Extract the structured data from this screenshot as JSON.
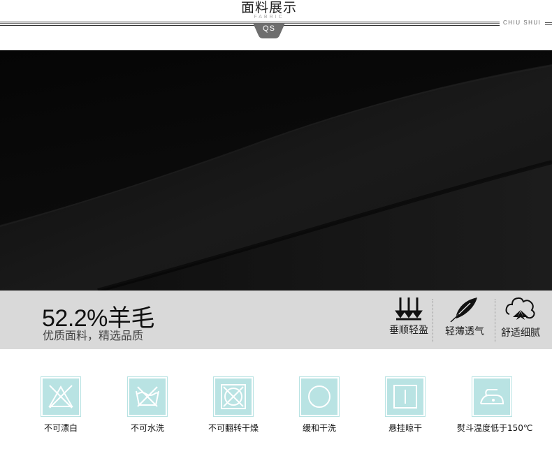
{
  "header": {
    "title": "面料展示",
    "subtitle": "FABRIC",
    "badge": "QS",
    "brand": "CHIU SHUI"
  },
  "material": {
    "percentage": "52.2%羊毛",
    "tagline": "优质面料，精选品质"
  },
  "features": [
    {
      "icon": "drape-arrows-icon",
      "label": "垂顺轻盈"
    },
    {
      "icon": "feather-icon",
      "label": "轻薄透气"
    },
    {
      "icon": "cotton-icon",
      "label": "舒适细腻"
    }
  ],
  "care": [
    {
      "icon": "no-bleach-icon",
      "label": "不可漂白"
    },
    {
      "icon": "no-wash-icon",
      "label": "不可水洗"
    },
    {
      "icon": "no-tumble-dry-icon",
      "label": "不可翻转干燥"
    },
    {
      "icon": "gentle-dry-clean-icon",
      "label": "缓和干洗"
    },
    {
      "icon": "hang-dry-icon",
      "label": "悬挂晾干"
    },
    {
      "icon": "iron-low-icon",
      "label": "熨斗温度低于150℃"
    }
  ],
  "colors": {
    "band": "#d9d9d9",
    "care_tile": "#b9e3e3",
    "fabric": "#050505"
  }
}
